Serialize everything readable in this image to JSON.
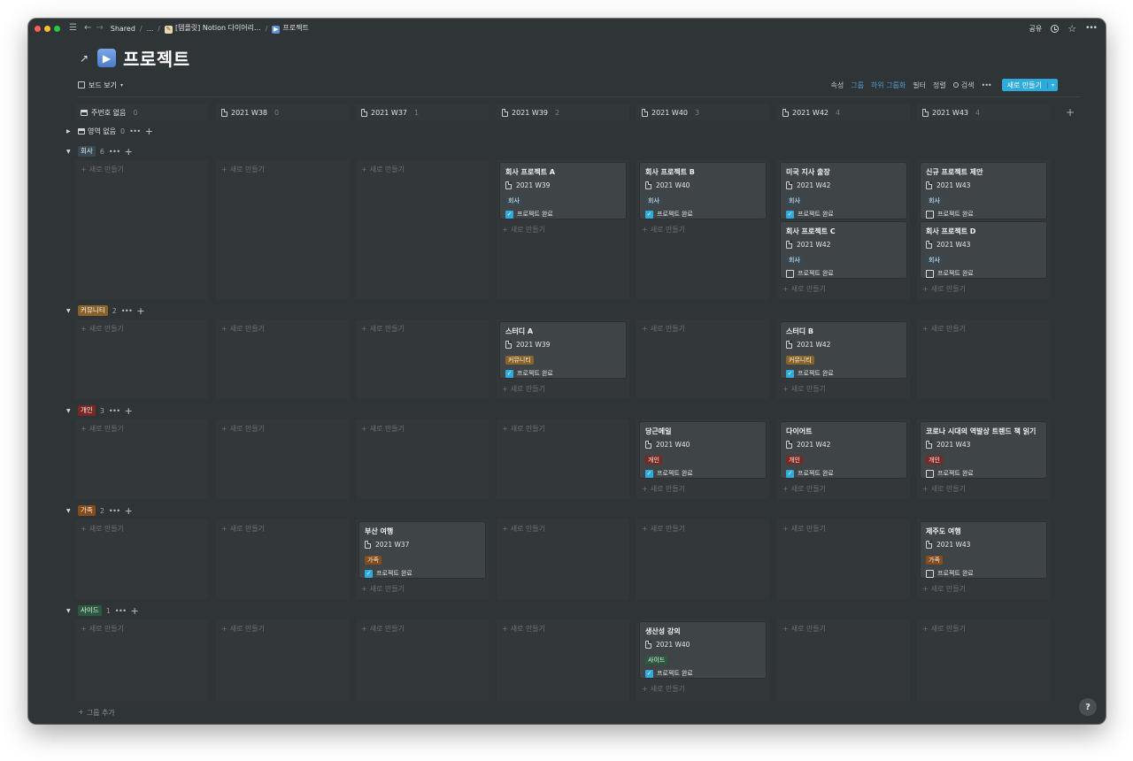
{
  "topbar": {
    "crumbs": [
      "Shared",
      "...",
      "[템플릿] Notion 다이어리...",
      "프로젝트"
    ],
    "share_label": "공유"
  },
  "page": {
    "title": "프로젝트",
    "icon": "play-button-icon"
  },
  "view": {
    "name": "보드 보기",
    "tools": [
      "속성",
      "그룹",
      "하위 그룹화",
      "필터",
      "정렬"
    ],
    "search": "검색",
    "new_label": "새로 만들기"
  },
  "columns": [
    {
      "label": "주번호 없음",
      "count": "0"
    },
    {
      "label": "2021 W38",
      "count": "0"
    },
    {
      "label": "2021 W37",
      "count": "1"
    },
    {
      "label": "2021 W39",
      "count": "2"
    },
    {
      "label": "2021 W40",
      "count": "3"
    },
    {
      "label": "2021 W42",
      "count": "4"
    },
    {
      "label": "2021 W43",
      "count": "4"
    }
  ],
  "add_new": "새로 만들기",
  "check_label": "프로젝트 완료",
  "groups": [
    {
      "label": "영역 없음",
      "count": "0"
    },
    {
      "label": "회사",
      "count": "6"
    },
    {
      "label": "커뮤니티",
      "count": "2"
    },
    {
      "label": "개인",
      "count": "3"
    },
    {
      "label": "가족",
      "count": "2"
    },
    {
      "label": "사이드",
      "count": "1"
    }
  ],
  "cards": {
    "c1": {
      "title": "회사 프로젝트 A",
      "week": "2021 W39",
      "tag": "회사",
      "done": true
    },
    "c2": {
      "title": "회사 프로젝트 B",
      "week": "2021 W40",
      "tag": "회사",
      "done": true
    },
    "c3": {
      "title": "미국 지사 출장",
      "week": "2021 W42",
      "tag": "회사",
      "done": true
    },
    "c4": {
      "title": "회사 프로젝트 C",
      "week": "2021 W42",
      "tag": "회사",
      "done": false
    },
    "c5": {
      "title": "신규 프로젝트 제안",
      "week": "2021 W43",
      "tag": "회사",
      "done": false
    },
    "c6": {
      "title": "회사 프로젝트 D",
      "week": "2021 W43",
      "tag": "회사",
      "done": false
    },
    "c7": {
      "title": "스터디 A",
      "week": "2021 W39",
      "tag": "커뮤니티",
      "done": true
    },
    "c8": {
      "title": "스터디 B",
      "week": "2021 W42",
      "tag": "커뮤니티",
      "done": true
    },
    "c9": {
      "title": "당근메일",
      "week": "2021 W40",
      "tag": "개인",
      "done": true
    },
    "c10": {
      "title": "다이어트",
      "week": "2021 W42",
      "tag": "개인",
      "done": true
    },
    "c11": {
      "title": "코로나 시대의 역발상 트렌드 책 읽기",
      "week": "2021 W43",
      "tag": "개인",
      "done": false
    },
    "c12": {
      "title": "부산 여행",
      "week": "2021 W37",
      "tag": "가족",
      "done": true
    },
    "c13": {
      "title": "제주도 여행",
      "week": "2021 W43",
      "tag": "가족",
      "done": false
    },
    "c14": {
      "title": "생산성 강의",
      "week": "2021 W40",
      "tag": "사이드",
      "done": true
    }
  },
  "add_group": "그룹 추가",
  "help": "?",
  "colors": {
    "background": "#2f3437",
    "card": "#3f4447",
    "accent": "#2eaadc"
  }
}
